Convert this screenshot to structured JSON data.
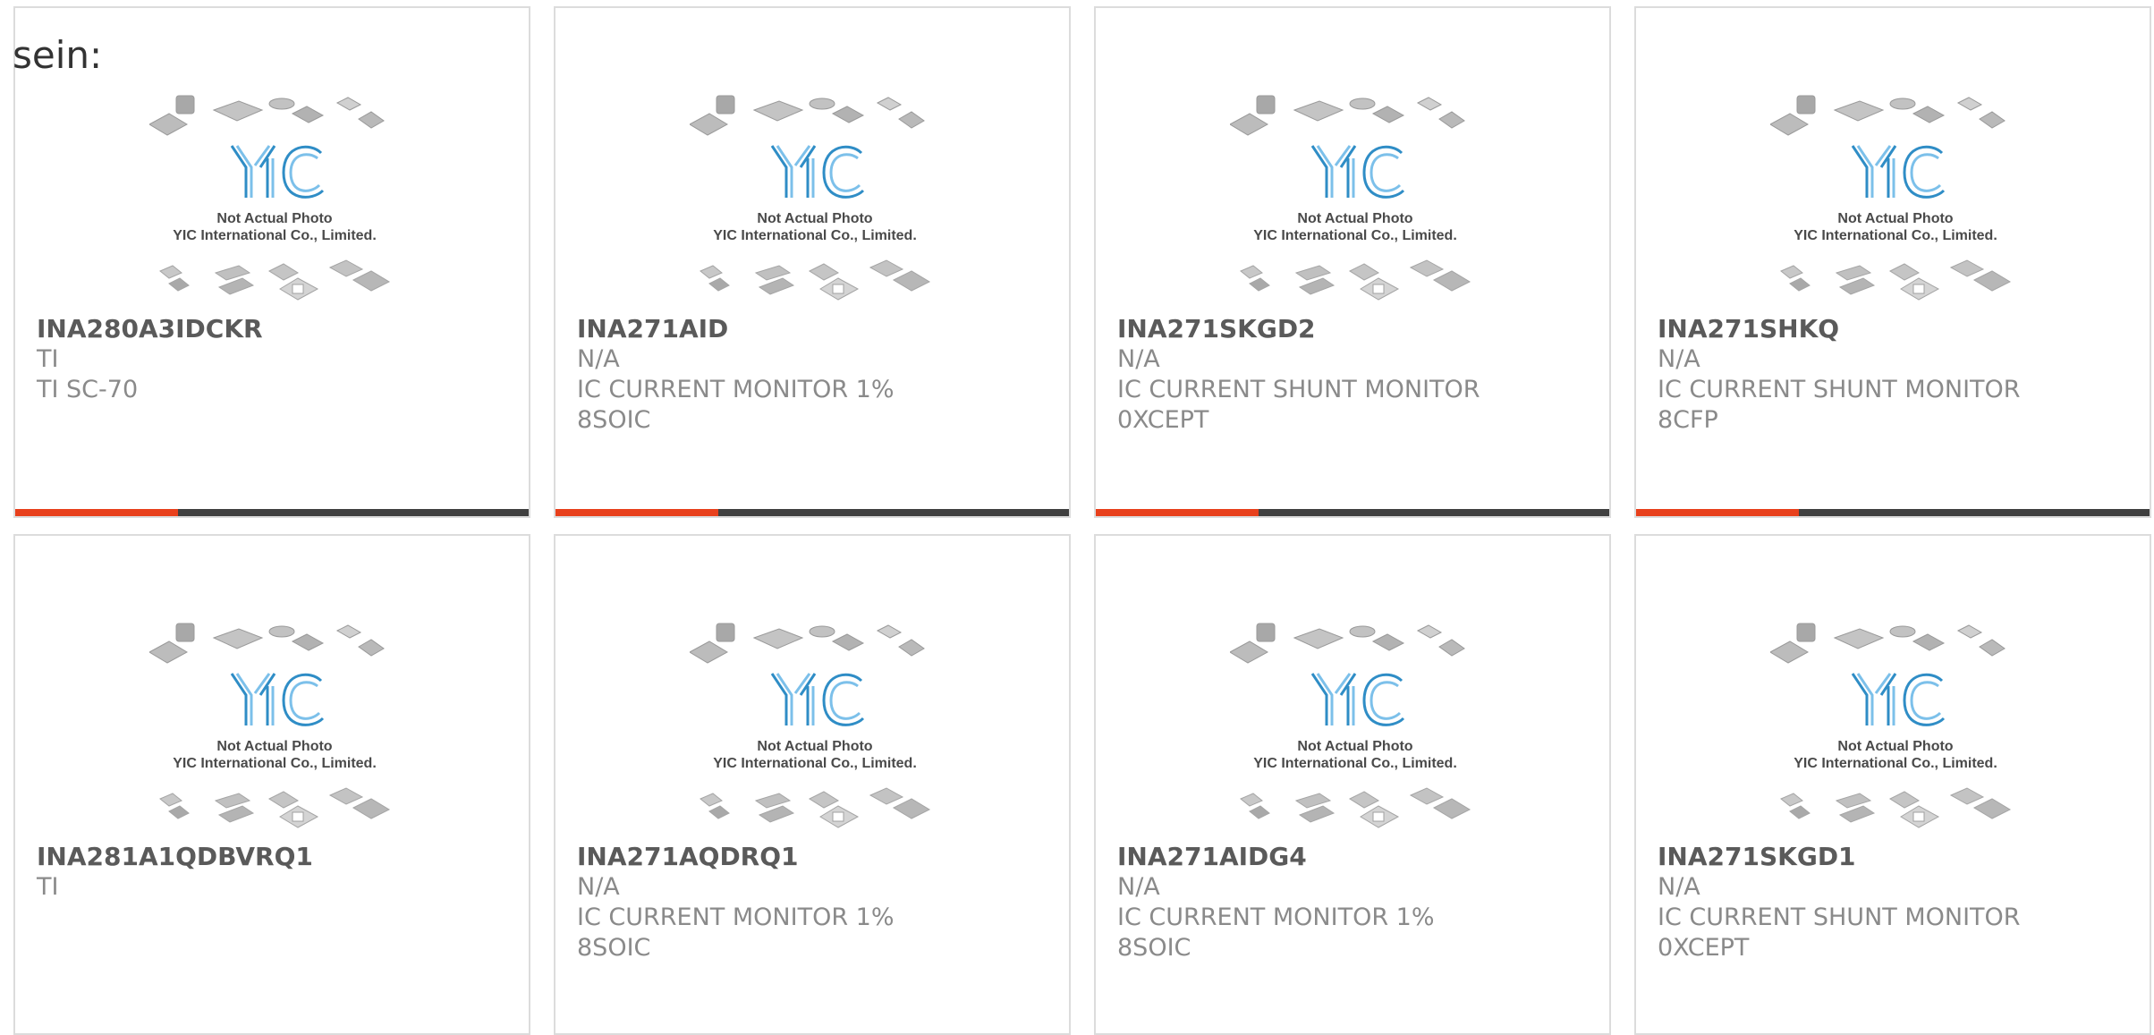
{
  "lead_text": "sein:",
  "accent_color": "#e8401c",
  "bar_color": "#404040",
  "placeholder": {
    "brand": "YIC",
    "line1": "Not Actual Photo",
    "line2": "YIC International Co., Limited."
  },
  "products": [
    {
      "part": "INA280A3IDCKR",
      "maker": "TI",
      "desc": "TI SC-70",
      "pkg": ""
    },
    {
      "part": "INA271AID",
      "maker": "N/A",
      "desc": "IC CURRENT MONITOR 1%",
      "pkg": "8SOIC"
    },
    {
      "part": "INA271SKGD2",
      "maker": "N/A",
      "desc": "IC CURRENT SHUNT MONITOR",
      "pkg": "0XCEPT"
    },
    {
      "part": "INA271SHKQ",
      "maker": "N/A",
      "desc": "IC CURRENT SHUNT MONITOR",
      "pkg": "8CFP"
    },
    {
      "part": "INA281A1QDBVRQ1",
      "maker": "TI",
      "desc": "",
      "pkg": ""
    },
    {
      "part": "INA271AQDRQ1",
      "maker": "N/A",
      "desc": "IC CURRENT MONITOR 1%",
      "pkg": "8SOIC"
    },
    {
      "part": "INA271AIDG4",
      "maker": "N/A",
      "desc": "IC CURRENT MONITOR 1%",
      "pkg": "8SOIC"
    },
    {
      "part": "INA271SKGD1",
      "maker": "N/A",
      "desc": "IC CURRENT SHUNT MONITOR",
      "pkg": "0XCEPT"
    }
  ]
}
